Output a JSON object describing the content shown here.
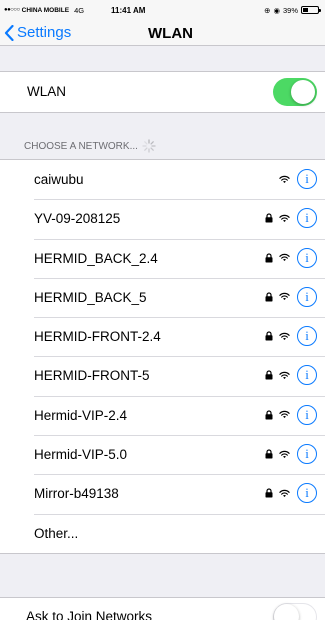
{
  "status_bar": {
    "signal": "●●○○○",
    "carrier": "CHINA MOBILE",
    "network": "4G",
    "time": "11:41 AM",
    "location_glyph": "⊕",
    "alarm_glyph": "◉",
    "battery_text": "39%",
    "battery_level": 0.39
  },
  "nav": {
    "back_label": "Settings",
    "title": "WLAN"
  },
  "wlan": {
    "label": "WLAN",
    "enabled": true
  },
  "section": {
    "header": "CHOOSE A NETWORK..."
  },
  "networks": [
    {
      "name": "caiwubu",
      "locked": false
    },
    {
      "name": "YV-09-208125",
      "locked": true
    },
    {
      "name": "HERMID_BACK_2.4",
      "locked": true
    },
    {
      "name": "HERMID_BACK_5",
      "locked": true
    },
    {
      "name": "HERMID-FRONT-2.4",
      "locked": true
    },
    {
      "name": "HERMID-FRONT-5",
      "locked": true
    },
    {
      "name": "Hermid-VIP-2.4",
      "locked": true
    },
    {
      "name": "Hermid-VIP-5.0",
      "locked": true
    },
    {
      "name": "Mirror-b49138",
      "locked": true
    },
    {
      "name": "Other...",
      "other": true
    }
  ],
  "ask_to_join": {
    "label": "Ask to Join Networks",
    "enabled": false
  },
  "colors": {
    "accent": "#0a7aff",
    "toggle_on": "#4cd964",
    "background": "#efeff4"
  }
}
